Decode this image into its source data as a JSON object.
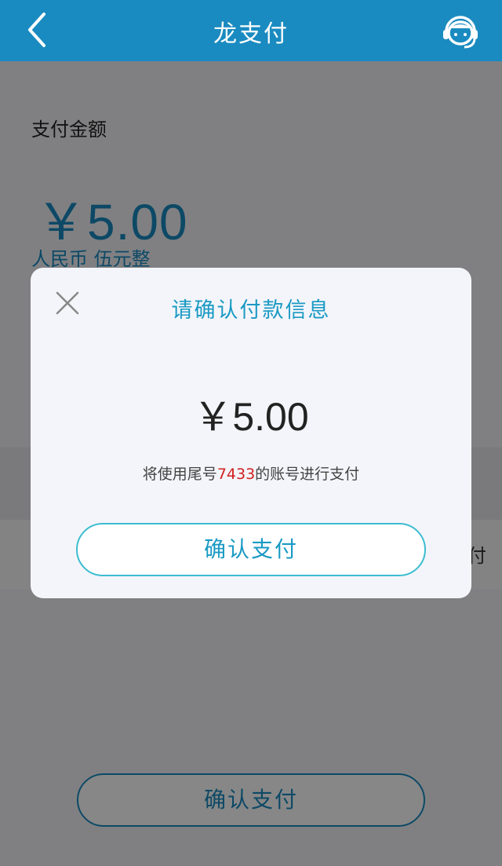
{
  "navbar": {
    "title": "龙支付",
    "back_icon": "chevron-left-icon",
    "support_icon": "customer-service-icon"
  },
  "payment": {
    "amount_label": "支付金额",
    "amount": "￥5.00",
    "amount_words": "人民币 伍元整"
  },
  "background_row": {
    "partial_text": "付"
  },
  "bottom_button": {
    "label": "确认支付"
  },
  "dialog": {
    "title": "请确认付款信息",
    "amount": "￥5.00",
    "info_prefix": "将使用尾号",
    "info_card_tail": "7433",
    "info_suffix": "的账号进行支付",
    "confirm_label": "确认支付",
    "close_icon": "close-icon"
  },
  "colors": {
    "navbar": "#1a8bc0",
    "accent": "#1a9ac4",
    "highlight": "#d11f1f",
    "overlay": "#7f7a80"
  }
}
